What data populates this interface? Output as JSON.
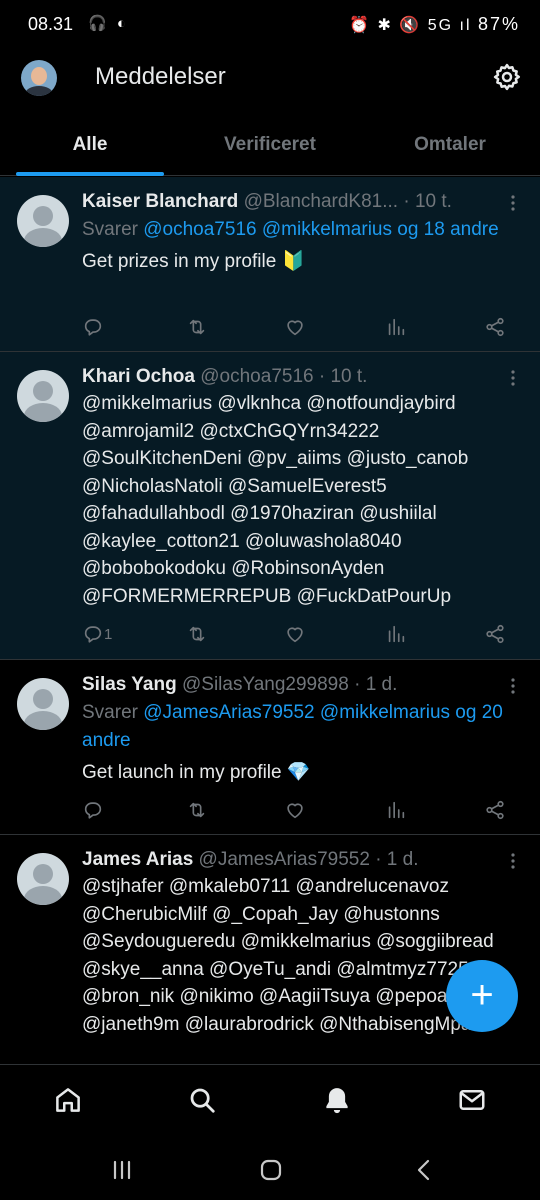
{
  "status_bar": {
    "time": "08.31",
    "left_icons": "🎧 ◐",
    "right_icons": "⏰ ✱ 🔇 5G ıl",
    "battery": "87%"
  },
  "header": {
    "title": "Meddelelser",
    "avatar_icon": "user-avatar",
    "settings_icon": "gear-icon"
  },
  "tabs": [
    {
      "label": "Alle",
      "active": true
    },
    {
      "label": "Verificeret",
      "active": false
    },
    {
      "label": "Omtaler",
      "active": false
    }
  ],
  "posts": [
    {
      "name": "Kaiser Blanchard",
      "handle": "@BlanchardK81...",
      "time": "· 10 t.",
      "reply_prefix": "Svarer ",
      "reply_mentions": "@ochoa7516 @mikkelmarius og 18 andre",
      "text": "Get prizes in my profile 🔰",
      "reply_count": ""
    },
    {
      "name": "Khari Ochoa",
      "handle": "@ochoa7516",
      "time": "· 10 t.",
      "mentions": "@mikkelmarius @vlknhca @notfoundjaybird @amrojamil2 @ctxChGQYrn34222 @SoulKitchenDeni @pv_aiims @justo_canob @NicholasNatoli @SamuelEverest5 @fahadullahbodl @1970haziran @ushiilal @kaylee_cotton21 @oluwashola8040 @bobobokodoku @RobinsonAyden @FORMERMERREPUB @FuckDatPourUp",
      "reply_count": "1"
    },
    {
      "name": "Silas Yang",
      "handle": "@SilasYang299898",
      "time": "· 1 d.",
      "reply_prefix": "Svarer ",
      "reply_mentions": "@JamesArias79552 @mikkelmarius og 20 andre",
      "text": "Get launch in my profile 💎",
      "reply_count": ""
    },
    {
      "name": "James Arias",
      "handle": "@JamesArias79552",
      "time": "· 1 d.",
      "mentions": "@stjhafer @mkaleb0711 @andrelucenavoz @CherubicMilf @_Copah_Jay @hustonns @Seydougueredu @mikkelmarius @soggiibread @skye__anna @OyeTu_andi @almtmyz772541 @bron_nik @nikimo @AagiiTsuya @pepoangel @janeth9m @laurabrodrick @NthabisengMpan1"
    }
  ],
  "fab": {
    "label": "+"
  },
  "bottom_nav": [
    "home-icon",
    "search-icon",
    "bell-icon",
    "mail-icon"
  ],
  "colors": {
    "accent": "#1d9bf0",
    "muted": "#71767b",
    "unread_bg": "#061a24",
    "text": "#e7e9ea"
  }
}
